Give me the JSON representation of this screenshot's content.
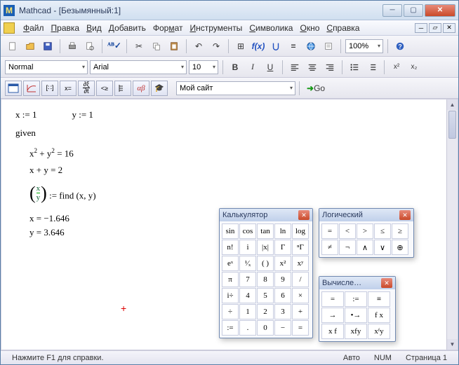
{
  "window": {
    "title": "Mathcad - [Безымянный:1]"
  },
  "menu": {
    "file": "Файл",
    "edit": "Правка",
    "view": "Вид",
    "insert": "Добавить",
    "format": "Формат",
    "tools": "Инструменты",
    "symbolic": "Символика",
    "window": "Окно",
    "help": "Справка"
  },
  "toolbar2": {
    "style": "Normal",
    "font": "Arial",
    "size": "10"
  },
  "toolbar3": {
    "mysite": "Мой сайт",
    "go": "Go"
  },
  "zoom": "100%",
  "worksheet": {
    "l1a": "x := 1",
    "l1b": "y := 1",
    "l2": "given",
    "l3_lhs_a": "x",
    "l3_lhs_b": " + y",
    "l3_eq": " = 16",
    "l4": "x + y = 2",
    "l5_v1": "x",
    "l5_v2": "y",
    "l5_rhs": " := find (x, y)",
    "l6": "x = −1.646",
    "l7": "y = 3.646"
  },
  "panels": {
    "calc": {
      "title": "Калькулятор",
      "cells": [
        "sin",
        "cos",
        "tan",
        "ln",
        "log",
        "n!",
        "i",
        "|x|",
        "Γ",
        "ⁿΓ",
        "eˣ",
        "¹⁄ₓ",
        "( )",
        "x²",
        "xʸ",
        "π",
        "7",
        "8",
        "9",
        "/",
        "i÷",
        "4",
        "5",
        "6",
        "×",
        "÷",
        "1",
        "2",
        "3",
        "+",
        ":=",
        ".",
        "0",
        "−",
        "="
      ]
    },
    "logic": {
      "title": "Логический",
      "cells": [
        "=",
        "<",
        ">",
        "≤",
        "≥",
        "≠",
        "¬",
        "∧",
        "∨",
        "⊕"
      ]
    },
    "eval": {
      "title": "Вычисле…",
      "cells": [
        "=",
        ":=",
        "≡",
        "→",
        "•→",
        "f x",
        "x f",
        "xfy",
        "xᶠy"
      ]
    }
  },
  "status": {
    "hint": "Нажмите F1 для справки.",
    "auto": "Авто",
    "num": "NUM",
    "page": "Страница 1"
  }
}
